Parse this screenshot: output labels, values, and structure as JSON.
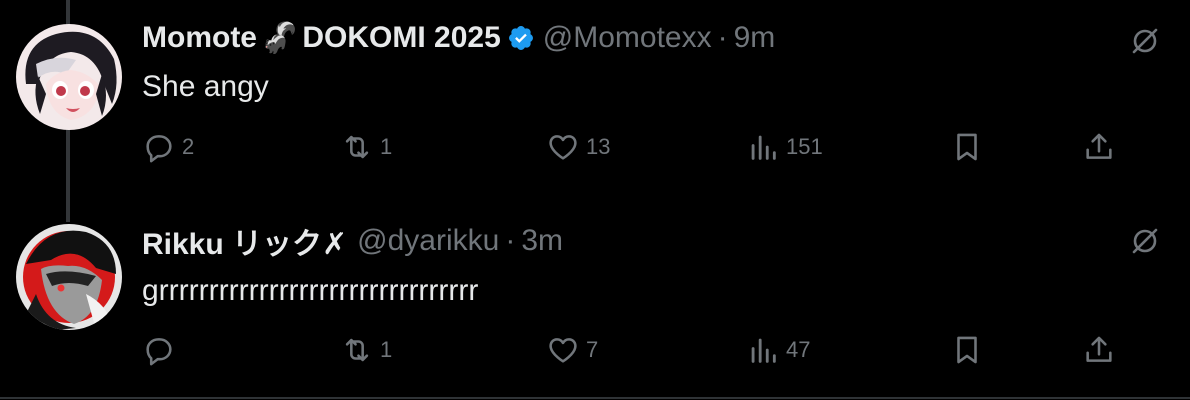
{
  "tweets": [
    {
      "display_name": "Momote",
      "name_emoji": "🦨",
      "name_suffix": "DOKOMI 2025",
      "verified": true,
      "handle": "@Momotexx",
      "separator": "·",
      "time": "9m",
      "text": "She angy",
      "replies": "2",
      "reposts": "1",
      "likes": "13",
      "views": "151",
      "avatar_icon": "anime-girl-avatar"
    },
    {
      "display_name": "Rikku リック✗",
      "verified": false,
      "handle": "@dyarikku",
      "separator": "·",
      "time": "3m",
      "text": "grrrrrrrrrrrrrrrrrrrrrrrrrrrrrrrr",
      "replies": "",
      "reposts": "1",
      "likes": "7",
      "views": "47",
      "avatar_icon": "hooded-character-avatar"
    }
  ],
  "colors": {
    "background": "#000000",
    "text_primary": "#e7e9ea",
    "text_secondary": "#71767b",
    "verified_blue": "#1d9bf0",
    "thread_line": "#333639"
  },
  "icons": {
    "reply": "reply-icon",
    "repost": "repost-icon",
    "like": "heart-icon",
    "views": "views-icon",
    "bookmark": "bookmark-icon",
    "share": "share-icon",
    "more": "grok-icon"
  }
}
